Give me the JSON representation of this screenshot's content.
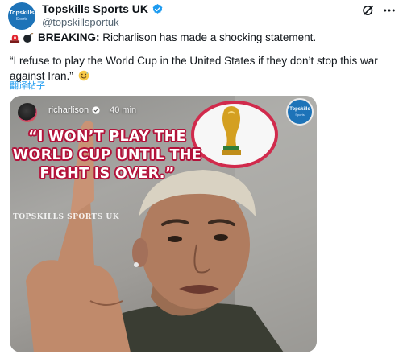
{
  "account": {
    "display_name": "Topskills Sports UK",
    "handle": "@topskillsportuk",
    "avatar_text_top": "Topskills",
    "avatar_text_bottom": "Sports"
  },
  "icons": {
    "verified": "verified-badge-icon",
    "grok": "grok-icon",
    "more": "more-options-icon",
    "siren": "siren-emoji",
    "bomb": "bomb-emoji",
    "smile": "sweat-smile-emoji"
  },
  "tweet": {
    "breaking_label": "BREAKING:",
    "breaking_text": " Richarlison has made a shocking statement.",
    "quote": "“I refuse to play the World Cup in the United States if they don’t stop this war against Iran.”",
    "translate_link": "翻译帖子"
  },
  "media": {
    "ig_username": "richarlison",
    "ig_time": "40 min",
    "headline_lines": [
      "“I WON’T PLAY THE",
      "WORLD CUP UNTIL THE",
      "FIGHT IS OVER.”"
    ],
    "watermark": "TOPSKILLS SPORTS UK",
    "logo_top": "Topskills",
    "logo_bottom": "Sports"
  },
  "colors": {
    "brand_blue": "#1d73b8",
    "verified_blue": "#1d9bf0",
    "headline_outline": "#b3123a",
    "trophy_ring": "#d12a4c",
    "link_blue": "#1d9bf0"
  }
}
